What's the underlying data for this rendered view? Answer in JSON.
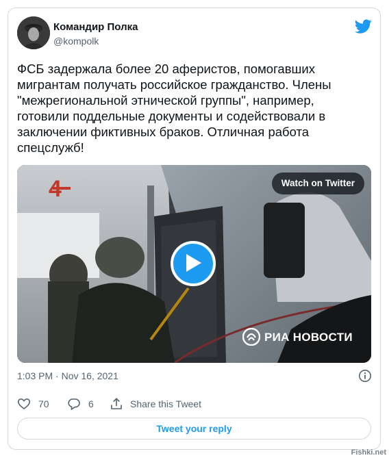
{
  "author": {
    "name": "Командир Полка",
    "handle": "@kompolk",
    "avatar_icon": "avatar-photo"
  },
  "brand_icon": "twitter-bird-icon",
  "tweet": {
    "text": "ФСБ задержала более 20 аферистов, помогавших мигрантам получать российское гражданство. Члены \"межрегиональной этнической группы\", например, готовили поддельные документы и содействовали в заключении фиктивных браков. Отличная работа спецслужб!",
    "timestamp": "1:03 PM · Nov 16, 2021"
  },
  "media": {
    "watch_label": "Watch on Twitter",
    "play_icon": "play-icon",
    "overlay_logo_text": "РИА НОВОСТИ",
    "door_number": "4"
  },
  "actions": {
    "likes": "70",
    "replies": "6",
    "share_label": "Share this Tweet"
  },
  "reply_button": "Tweet your reply",
  "watermark": "Fishki.net",
  "colors": {
    "accent": "#1d9bf0",
    "text": "#0f1419",
    "muted": "#536471",
    "border": "#cfd9de"
  }
}
